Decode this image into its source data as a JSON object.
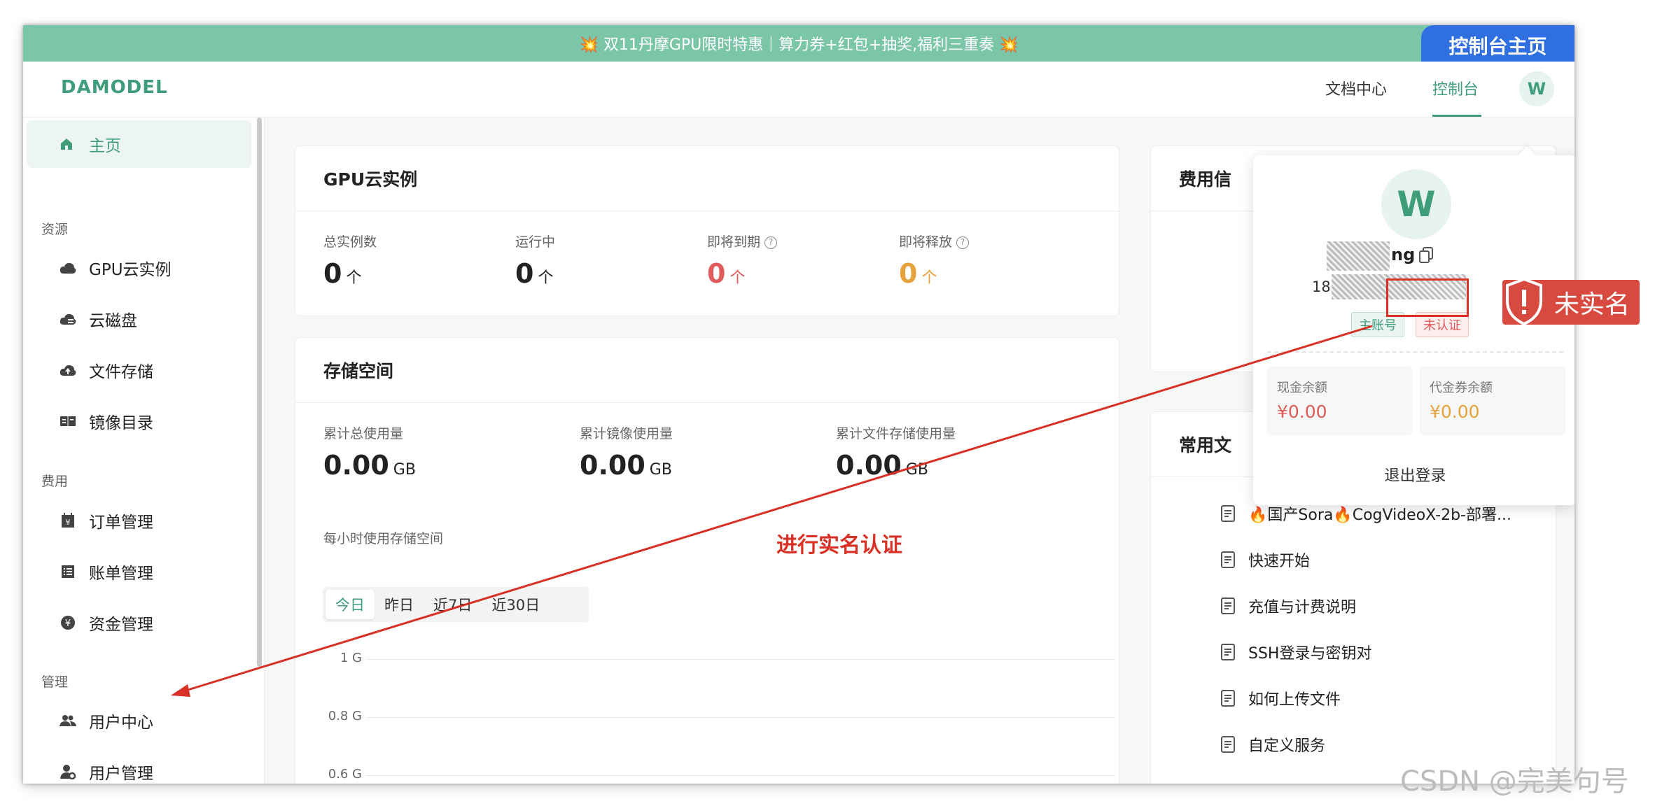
{
  "banner": {
    "text": "💥 双11丹摩GPU限时特惠｜算力券+红包+抽奖,福利三重奏 💥",
    "tag": "控制台主页"
  },
  "topbar": {
    "logo": "DAMODEL",
    "docs": "文档中心",
    "console": "控制台",
    "avatar": "W"
  },
  "sidebar": {
    "home": "主页",
    "groups": {
      "resources": "资源",
      "billing": "费用",
      "manage": "管理"
    },
    "items": {
      "gpu": "GPU云实例",
      "disk": "云磁盘",
      "file": "文件存储",
      "image": "镜像目录",
      "order": "订单管理",
      "bill": "账单管理",
      "fund": "资金管理",
      "user_center": "用户中心",
      "user_manage": "用户管理"
    }
  },
  "gpu_card": {
    "title": "GPU云实例",
    "stats": [
      {
        "label": "总实例数",
        "value": "0",
        "unit": "个"
      },
      {
        "label": "运行中",
        "value": "0",
        "unit": "个"
      },
      {
        "label": "即将到期",
        "value": "0",
        "unit": "个"
      },
      {
        "label": "即将释放",
        "value": "0",
        "unit": "个"
      }
    ],
    "colors": {
      "normal": "#222222",
      "expiring": "#e05b5b",
      "releasing": "#e6a23c"
    }
  },
  "storage_card": {
    "title": "存储空间",
    "stats": [
      {
        "label": "累计总使用量",
        "value": "0.00",
        "unit": "GB"
      },
      {
        "label": "累计镜像使用量",
        "value": "0.00",
        "unit": "GB"
      },
      {
        "label": "累计文件存储使用量",
        "value": "0.00",
        "unit": "GB"
      }
    ],
    "hourly_label": "每小时使用存储空间",
    "tabs": [
      "今日",
      "昨日",
      "近7日",
      "近30日"
    ],
    "y_ticks": [
      "1 G",
      "0.8 G",
      "0.6 G"
    ]
  },
  "right_cards": {
    "fee_title": "费用信",
    "docs_title": "常用文"
  },
  "docs": [
    "🔥国产Sora🔥CogVideoX-2b-部署...",
    "快速开始",
    "充值与计费说明",
    "SSH登录与密钥对",
    "如何上传文件",
    "自定义服务"
  ],
  "popup": {
    "avatar": "W",
    "name_suffix": "ng",
    "phone_prefix": "18",
    "tags": {
      "main": "主账号",
      "unverified": "未认证"
    },
    "cash_label": "现金余额",
    "cash_value": "¥0.00",
    "voucher_label": "代金券余额",
    "voucher_value": "¥0.00",
    "logout": "退出登录"
  },
  "annotations": {
    "badge": "未实名",
    "instruction": "进行实名认证",
    "accent": "#d93025"
  },
  "watermark": "CSDN @完美句号",
  "theme": {
    "accent": "#3f9d7a",
    "banner": "#7bc6a8",
    "console_tag": "#2f6fe0"
  }
}
